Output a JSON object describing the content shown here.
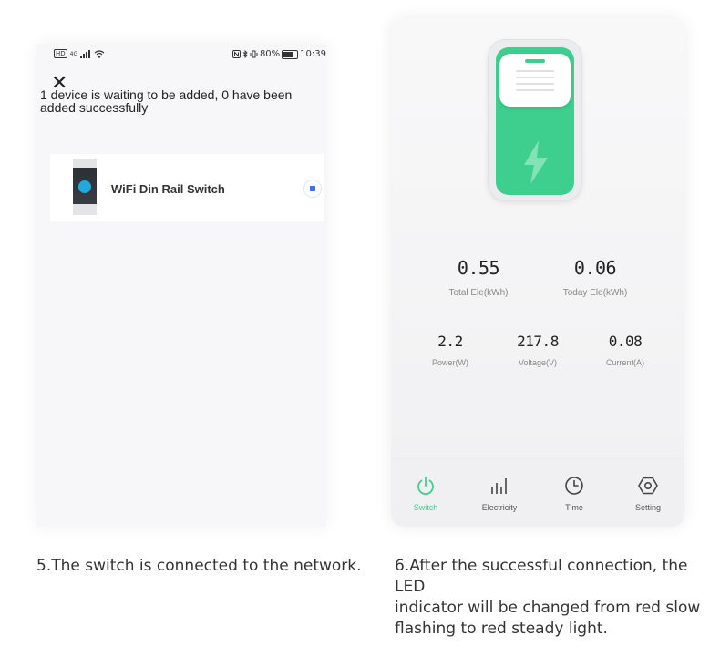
{
  "left_screen": {
    "status_bar": {
      "hd": "HD",
      "network": "4G",
      "battery": "80%",
      "time": "10:39"
    },
    "close_icon": "close-icon",
    "waiting_text": "1 device is waiting to be added, 0 have been added successfully",
    "device": {
      "name": "WiFi Din Rail Switch"
    }
  },
  "right_screen": {
    "stats_top": [
      {
        "value": "0.55",
        "label": "Total Ele(kWh)"
      },
      {
        "value": "0.06",
        "label": "Today Ele(kWh)"
      }
    ],
    "stats_bottom": [
      {
        "value": "2.2",
        "label": "Power(W)"
      },
      {
        "value": "217.8",
        "label": "Voltage(V)"
      },
      {
        "value": "0.08",
        "label": "Current(A)"
      }
    ],
    "nav": [
      {
        "label": "Switch",
        "icon": "power-icon",
        "active": true
      },
      {
        "label": "Electricity",
        "icon": "bars-icon",
        "active": false
      },
      {
        "label": "Time",
        "icon": "clock-icon",
        "active": false
      },
      {
        "label": "Setting",
        "icon": "hexagon-gear-icon",
        "active": false
      }
    ],
    "accent_color": "#3ecf8e"
  },
  "captions": {
    "left": "5.The switch is connected to the network.",
    "right_line1": "6.After the successful connection, the LED",
    "right_line2": "indicator will be changed from red slow",
    "right_line3": "flashing to red steady light."
  }
}
